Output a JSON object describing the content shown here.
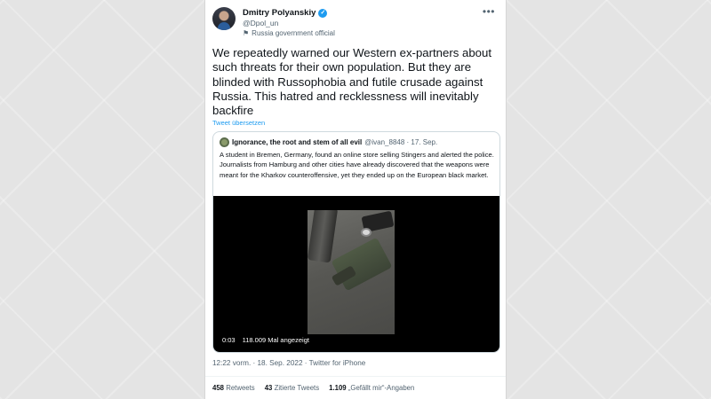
{
  "author": {
    "name": "Dmitry Polyanskiy",
    "verified_mark": "✓",
    "handle": "@Dpol_un",
    "label_icon": "flag-icon",
    "label": "Russia government official",
    "more_icon": "more-icon"
  },
  "tweet": {
    "text": "We repeatedly warned our Western ex-partners about such threats for their own population. But they are blinded with Russophobia and futile crusade against Russia. This hatred and recklessness will inevitably backfire",
    "translate": "Tweet übersetzen"
  },
  "quote": {
    "name": "Ignorance, the root and stem of all evil",
    "meta": "@ivan_8848 · 17. Sep.",
    "text": "A student in Bremen, Germany, found an online store selling Stingers and alerted the police.  Journalists from Hamburg and other cities have already discovered that the weapons were meant for the Kharkov counteroffensive, yet they ended up on the European black market.",
    "video_time": "0:03",
    "video_views": "118.009 Mal angezeigt"
  },
  "timestamp": "12:22 vorm. · 18. Sep. 2022 · Twitter for iPhone",
  "stats": {
    "retweets_count": "458",
    "retweets_label": "Retweets",
    "quotes_count": "43",
    "quotes_label": "Zitierte Tweets",
    "likes_count": "1.109",
    "likes_label": "„Gefällt mir“-Angaben"
  },
  "colors": {
    "accent": "#1d9bf0",
    "text": "#0f1419",
    "secondary": "#536471"
  }
}
